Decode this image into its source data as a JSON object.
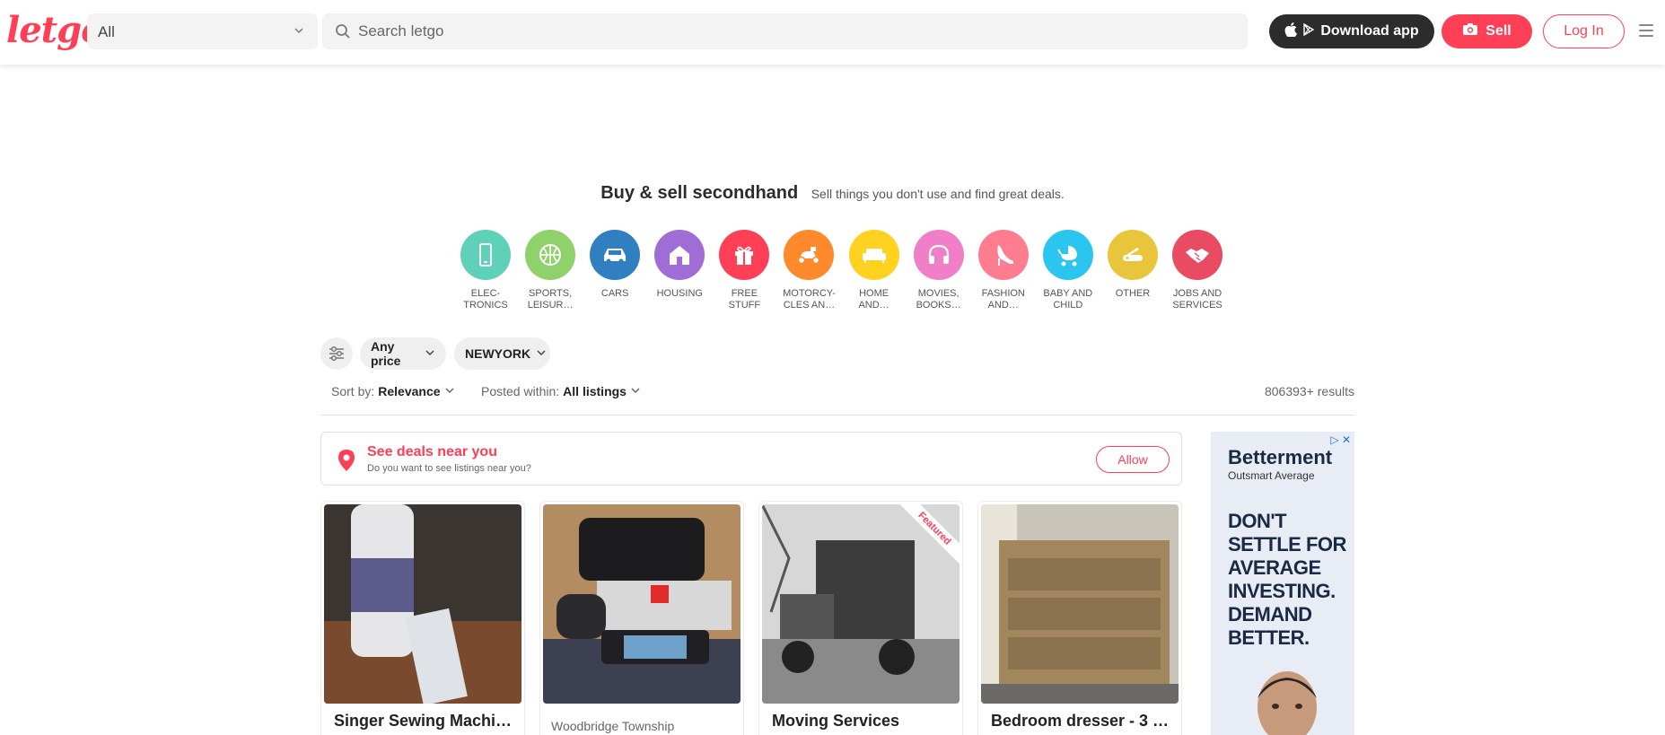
{
  "header": {
    "logo": "letgo",
    "category_select": "All",
    "search_placeholder": "Search letgo",
    "download_label": "Download app",
    "sell_label": "Sell",
    "login_label": "Log In"
  },
  "hero": {
    "title": "Buy & sell secondhand",
    "subtitle": "Sell things you don't use and find great deals."
  },
  "categories": [
    {
      "line1": "ELEC-",
      "line2": "TRONICS",
      "color": "#5fd1b9",
      "icon": "phone-icon"
    },
    {
      "line1": "SPORTS,",
      "line2": "LEISUR…",
      "color": "#8fd16a",
      "icon": "basketball-icon"
    },
    {
      "line1": "CARS",
      "line2": "",
      "color": "#2f7fc1",
      "icon": "car-icon"
    },
    {
      "line1": "HOUSING",
      "line2": "",
      "color": "#a06cd5",
      "icon": "house-icon"
    },
    {
      "line1": "FREE",
      "line2": "STUFF",
      "color": "#ff3f55",
      "icon": "gift-icon"
    },
    {
      "line1": "MOTORCY-",
      "line2": "CLES AN…",
      "color": "#ff8a2b",
      "icon": "scooter-icon"
    },
    {
      "line1": "HOME",
      "line2": "AND…",
      "color": "#ffd21f",
      "icon": "sofa-icon"
    },
    {
      "line1": "MOVIES,",
      "line2": "BOOKS…",
      "color": "#f07ec8",
      "icon": "headphones-icon"
    },
    {
      "line1": "FASHION",
      "line2": "AND…",
      "color": "#ff7d8e",
      "icon": "heel-icon"
    },
    {
      "line1": "BABY AND",
      "line2": "CHILD",
      "color": "#2bc6f0",
      "icon": "stroller-icon"
    },
    {
      "line1": "OTHER",
      "line2": "",
      "color": "#e8c53a",
      "icon": "pocketknife-icon"
    },
    {
      "line1": "JOBS AND",
      "line2": "SERVICES",
      "color": "#e94b62",
      "icon": "handshake-icon"
    }
  ],
  "filters": {
    "price_label": "Any price",
    "location_label": "NEWYORK",
    "sort_prefix": "Sort by:",
    "sort_value": "Relevance",
    "posted_prefix": "Posted within:",
    "posted_value": "All listings",
    "results": "806393+ results"
  },
  "location_prompt": {
    "title": "See deals near you",
    "subtitle": "Do you want to see listings near you?",
    "allow_label": "Allow"
  },
  "listings": [
    {
      "title": "Singer Sewing Machi…",
      "location": "",
      "featured": false
    },
    {
      "title": "",
      "location": "Woodbridge Township",
      "featured": false
    },
    {
      "title": "Moving Services",
      "location": "",
      "featured": true,
      "badge": "Featured"
    },
    {
      "title": "Bedroom dresser - 3 …",
      "location": "",
      "featured": false
    }
  ],
  "ad": {
    "brand": "Betterment",
    "tagline": "Outsmart Average",
    "headline": "DON'T SETTLE FOR AVERAGE INVESTING. DEMAND BETTER."
  },
  "colors": {
    "brand": "#ff3f55",
    "dark": "#2c2c2c"
  }
}
